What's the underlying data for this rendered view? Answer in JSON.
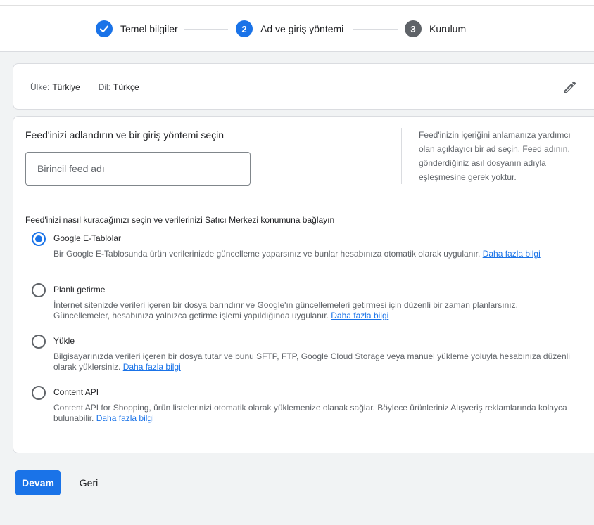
{
  "stepper": {
    "steps": [
      {
        "label": "Temel bilgiler",
        "state": "done",
        "number": ""
      },
      {
        "label": "Ad ve giriş yöntemi",
        "state": "active",
        "number": "2"
      },
      {
        "label": "Kurulum",
        "state": "pending",
        "number": "3"
      }
    ]
  },
  "locale": {
    "country_label": "Ülke:",
    "country_value": "Türkiye",
    "language_label": "Dil:",
    "language_value": "Türkçe",
    "edit_icon": "pencil-icon"
  },
  "feed_name": {
    "title": "Feed'inizi adlandırın ve bir giriş yöntemi seçin",
    "placeholder": "Birincil feed adı",
    "value": "",
    "help_text": "Feed'inizin içeriğini anlamanıza yardımcı olan açıklayıcı bir ad seçin. Feed adının, gönderdiğiniz asıl dosyanın adıyla eşleşmesine gerek yoktur."
  },
  "method": {
    "title": "Feed'inizi nasıl kuracağınızı seçin ve verilerinizi Satıcı Merkezi konumuna bağlayın",
    "options": [
      {
        "label": "Google E-Tablolar",
        "checked": true,
        "description": "Bir Google E-Tablosunda ürün verilerinizde güncelleme yaparsınız ve bunlar hesabınıza otomatik olarak uygulanır.",
        "link": "Daha fazla bilgi"
      },
      {
        "label": "Planlı getirme",
        "checked": false,
        "description": "İnternet sitenizde verileri içeren bir dosya barındırır ve Google'ın güncellemeleri getirmesi için düzenli bir zaman planlarsınız. Güncellemeler, hesabınıza yalnızca getirme işlemi yapıldığında uygulanır.",
        "link": "Daha fazla bilgi"
      },
      {
        "label": "Yükle",
        "checked": false,
        "description": "Bilgisayarınızda verileri içeren bir dosya tutar ve bunu SFTP, FTP, Google Cloud Storage veya manuel yükleme yoluyla hesabınıza düzenli olarak yüklersiniz.",
        "link": "Daha fazla bilgi"
      },
      {
        "label": "Content API",
        "checked": false,
        "description": "Content API for Shopping, ürün listelerinizi otomatik olarak yüklemenize olanak sağlar. Böylece ürünleriniz Alışveriş reklamlarında kolayca bulunabilir.",
        "link": "Daha fazla bilgi"
      }
    ]
  },
  "actions": {
    "continue_label": "Devam",
    "back_label": "Geri"
  },
  "colors": {
    "accent": "#1a73e8",
    "pending_step": "#5f6368"
  }
}
